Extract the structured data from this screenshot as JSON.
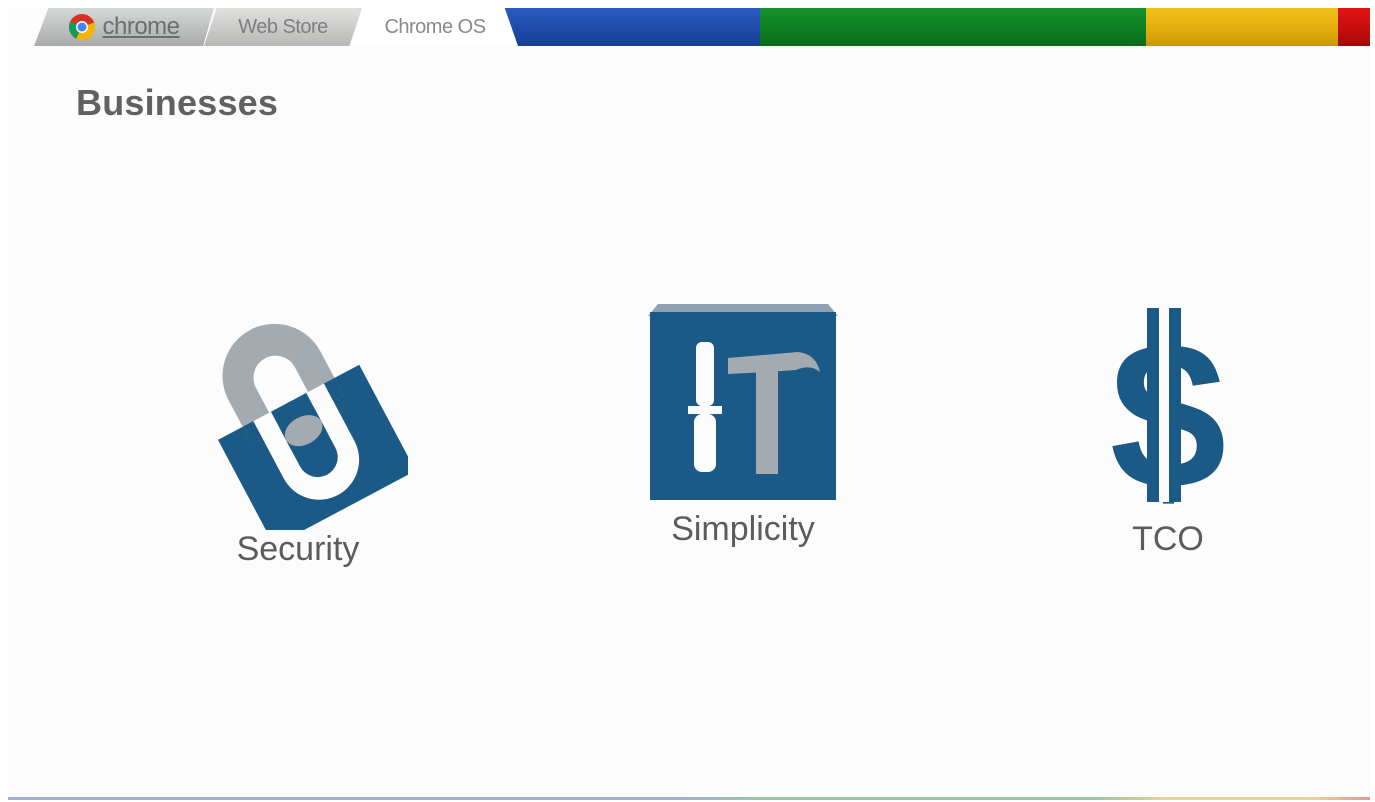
{
  "tabs": [
    {
      "label": "chrome",
      "icon": "chrome-logo-icon"
    },
    {
      "label": "Web Store"
    },
    {
      "label": "Chrome OS",
      "active": true
    }
  ],
  "stripe_colors": [
    "#1c4aa8",
    "#0e7d22",
    "#e0ac0e",
    "#c40c0c"
  ],
  "page": {
    "title": "Businesses"
  },
  "features": [
    {
      "label": "Security",
      "icon": "padlock-icon"
    },
    {
      "label": "Simplicity",
      "icon": "tools-box-icon"
    },
    {
      "label": "TCO",
      "icon": "dollar-sign-icon"
    }
  ],
  "colors": {
    "icon_blue": "#1b5a86",
    "icon_gray": "#a3aab0",
    "title_gray": "#5f6163"
  }
}
